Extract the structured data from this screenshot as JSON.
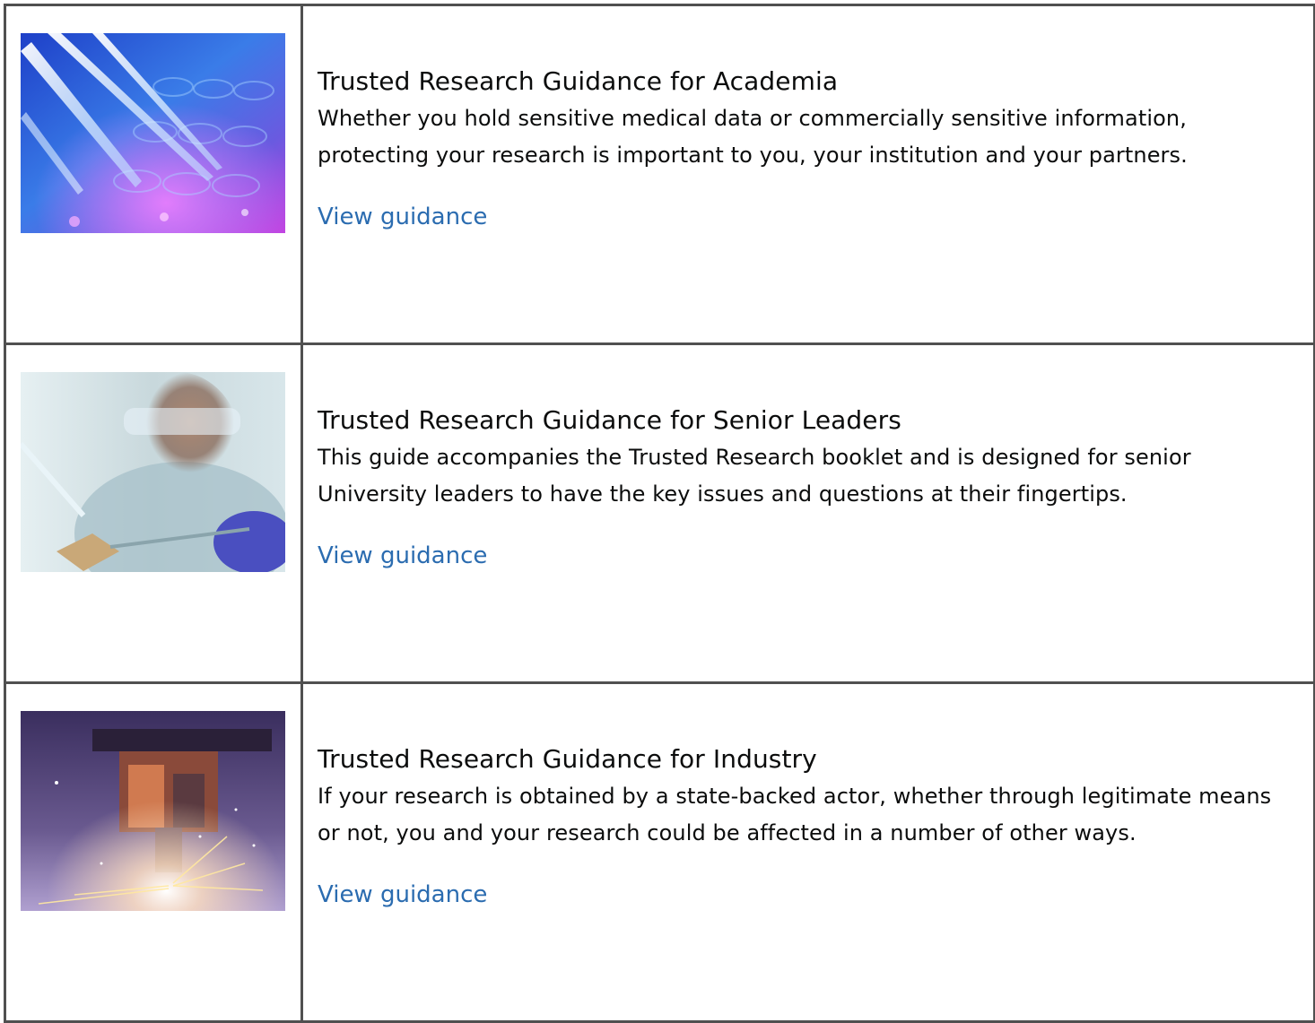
{
  "colors": {
    "border": "#505050",
    "text": "#0b0c0c",
    "link": "#2b6cb0"
  },
  "guidance": [
    {
      "image_icon": "lab-pipettes-image",
      "title": "Trusted Research Guidance for Academia",
      "description": "Whether you hold sensitive medical data or commercially sensitive information, protecting your research is important to you, your institution and your partners.",
      "link_label": "View guidance"
    },
    {
      "image_icon": "scientist-microchip-image",
      "title": "Trusted Research Guidance for Senior Leaders",
      "description": "This guide accompanies the Trusted Research booklet and is designed for senior University leaders to have the key issues and questions at their fingertips.",
      "link_label": "View guidance"
    },
    {
      "image_icon": "laser-cutting-sparks-image",
      "title": "Trusted Research Guidance for Industry",
      "description": "If your research is obtained by a state-backed actor, whether through legitimate means or not, you and your research could be affected in a number of other ways.",
      "link_label": "View guidance"
    }
  ]
}
